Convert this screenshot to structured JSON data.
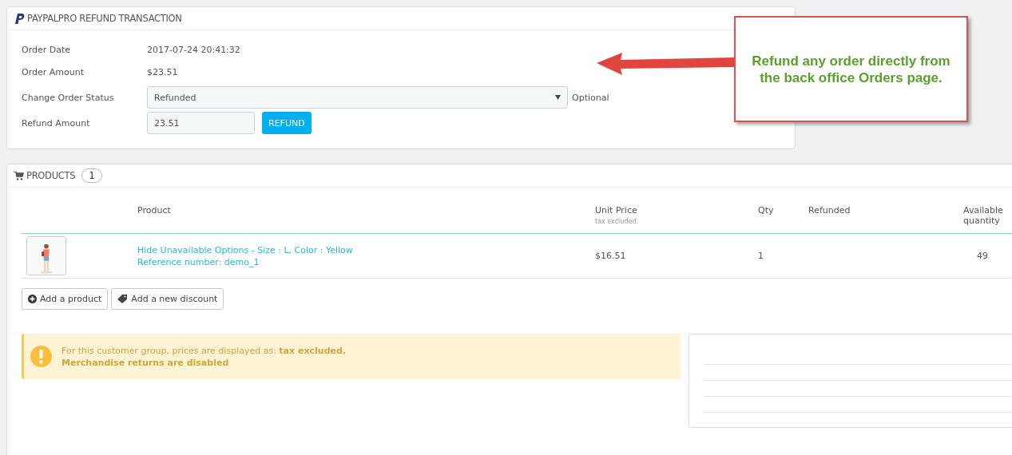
{
  "refund_panel": {
    "title": "PAYPALPRO REFUND TRANSACTION",
    "fields": [
      {
        "kind": "text",
        "label": "Order Date",
        "value": "2017-07-24 20:41:32"
      },
      {
        "kind": "text",
        "label": "Order Amount",
        "value": "$23.51"
      },
      {
        "kind": "select",
        "label": "Change Order Status",
        "value": "Refunded",
        "hint": "Optional"
      },
      {
        "kind": "input",
        "label": "Refund Amount",
        "value": "23.51",
        "button": "REFUND"
      }
    ]
  },
  "callout": {
    "text": "Refund any order directly from the back office Orders page."
  },
  "products_panel": {
    "title": "PRODUCTS",
    "count": "1",
    "columns": [
      {
        "label": "Product"
      },
      {
        "label": "Unit Price",
        "sub": "tax excluded."
      },
      {
        "label": "Qty"
      },
      {
        "label": "Refunded"
      },
      {
        "label": "Available quantity"
      }
    ],
    "rows": [
      {
        "name": "Hide Unavailable Options - Size : L, Color : Yellow",
        "reference": "Reference number: demo_1",
        "unit_price": "$16.51",
        "qty": "1",
        "available": "49"
      }
    ],
    "buttons": [
      {
        "kind": "add",
        "label": "Add a product"
      },
      {
        "kind": "discount",
        "label": "Add a new discount"
      }
    ],
    "alert": {
      "message": "For this customer group, prices are displayed as: **tax excluded.**",
      "note": "Merchandise returns are disabled"
    }
  }
}
